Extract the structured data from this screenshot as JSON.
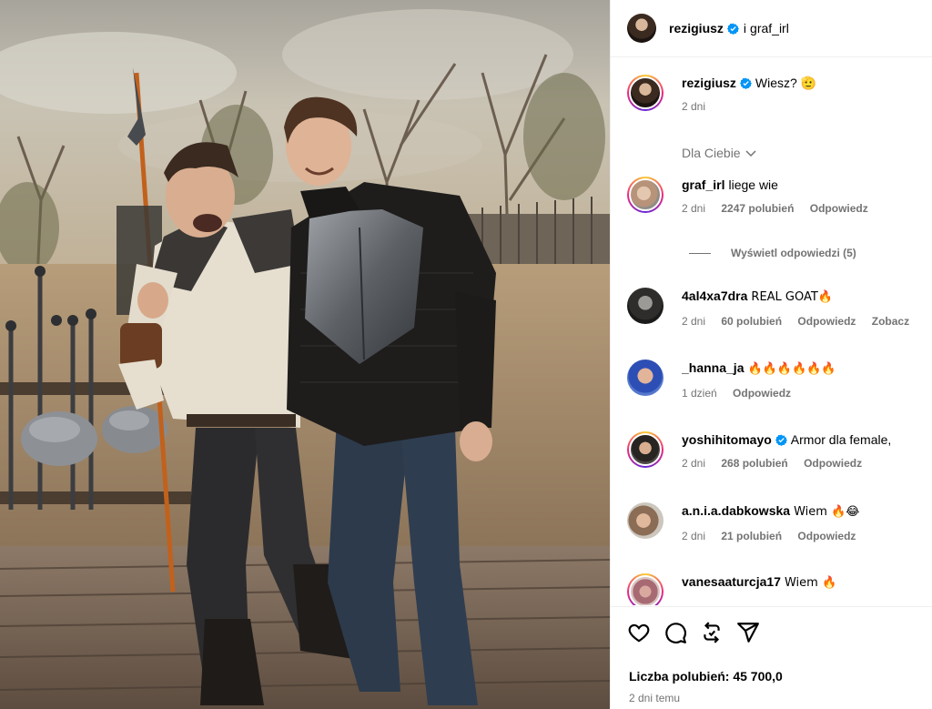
{
  "post": {
    "author": "rezigiusz",
    "connector": "i",
    "collaborator": "graf_irl"
  },
  "caption": {
    "user": "rezigiusz",
    "text": "Wiesz? 🫡",
    "time": "2 dni"
  },
  "filter": {
    "label": "Dla Ciebie"
  },
  "comments": [
    {
      "user": "graf_irl",
      "text": "liege wie",
      "time": "2 dni",
      "likes": "2247 polubień",
      "reply": "Odpowiedz",
      "extra": ""
    },
    {
      "user": "4al4xa7dra",
      "text": "REAL GOAT🔥",
      "time": "2 dni",
      "likes": "60 polubień",
      "reply": "Odpowiedz",
      "extra": "Zobacz"
    },
    {
      "user": "_hanna_ja",
      "text": "🔥🔥🔥🔥🔥🔥",
      "time": "1 dzień",
      "likes": "",
      "reply": "Odpowiedz",
      "extra": ""
    },
    {
      "user": "yoshihitomayo",
      "text": "Armor dla female, ",
      "time": "2 dni",
      "likes": "268 polubień",
      "reply": "Odpowiedz",
      "extra": ""
    },
    {
      "user": "a.n.i.a.dabkowska",
      "text": "Wiem 🔥😂",
      "time": "2 dni",
      "likes": "21 polubień",
      "reply": "Odpowiedz",
      "extra": ""
    },
    {
      "user": "vanesaaturcja17",
      "text": "Wiem 🔥",
      "time": "",
      "likes": "",
      "reply": "",
      "extra": ""
    }
  ],
  "view_replies": "Wyświetl odpowiedzi (5)",
  "footer": {
    "likes": "Liczba polubień: 45 700,0",
    "date": "2 dni temu"
  },
  "icons": [
    "heart-icon",
    "comment-icon",
    "repost-icon",
    "share-icon"
  ],
  "colors": {
    "verified": "#0095f6",
    "meta": "#737373"
  }
}
